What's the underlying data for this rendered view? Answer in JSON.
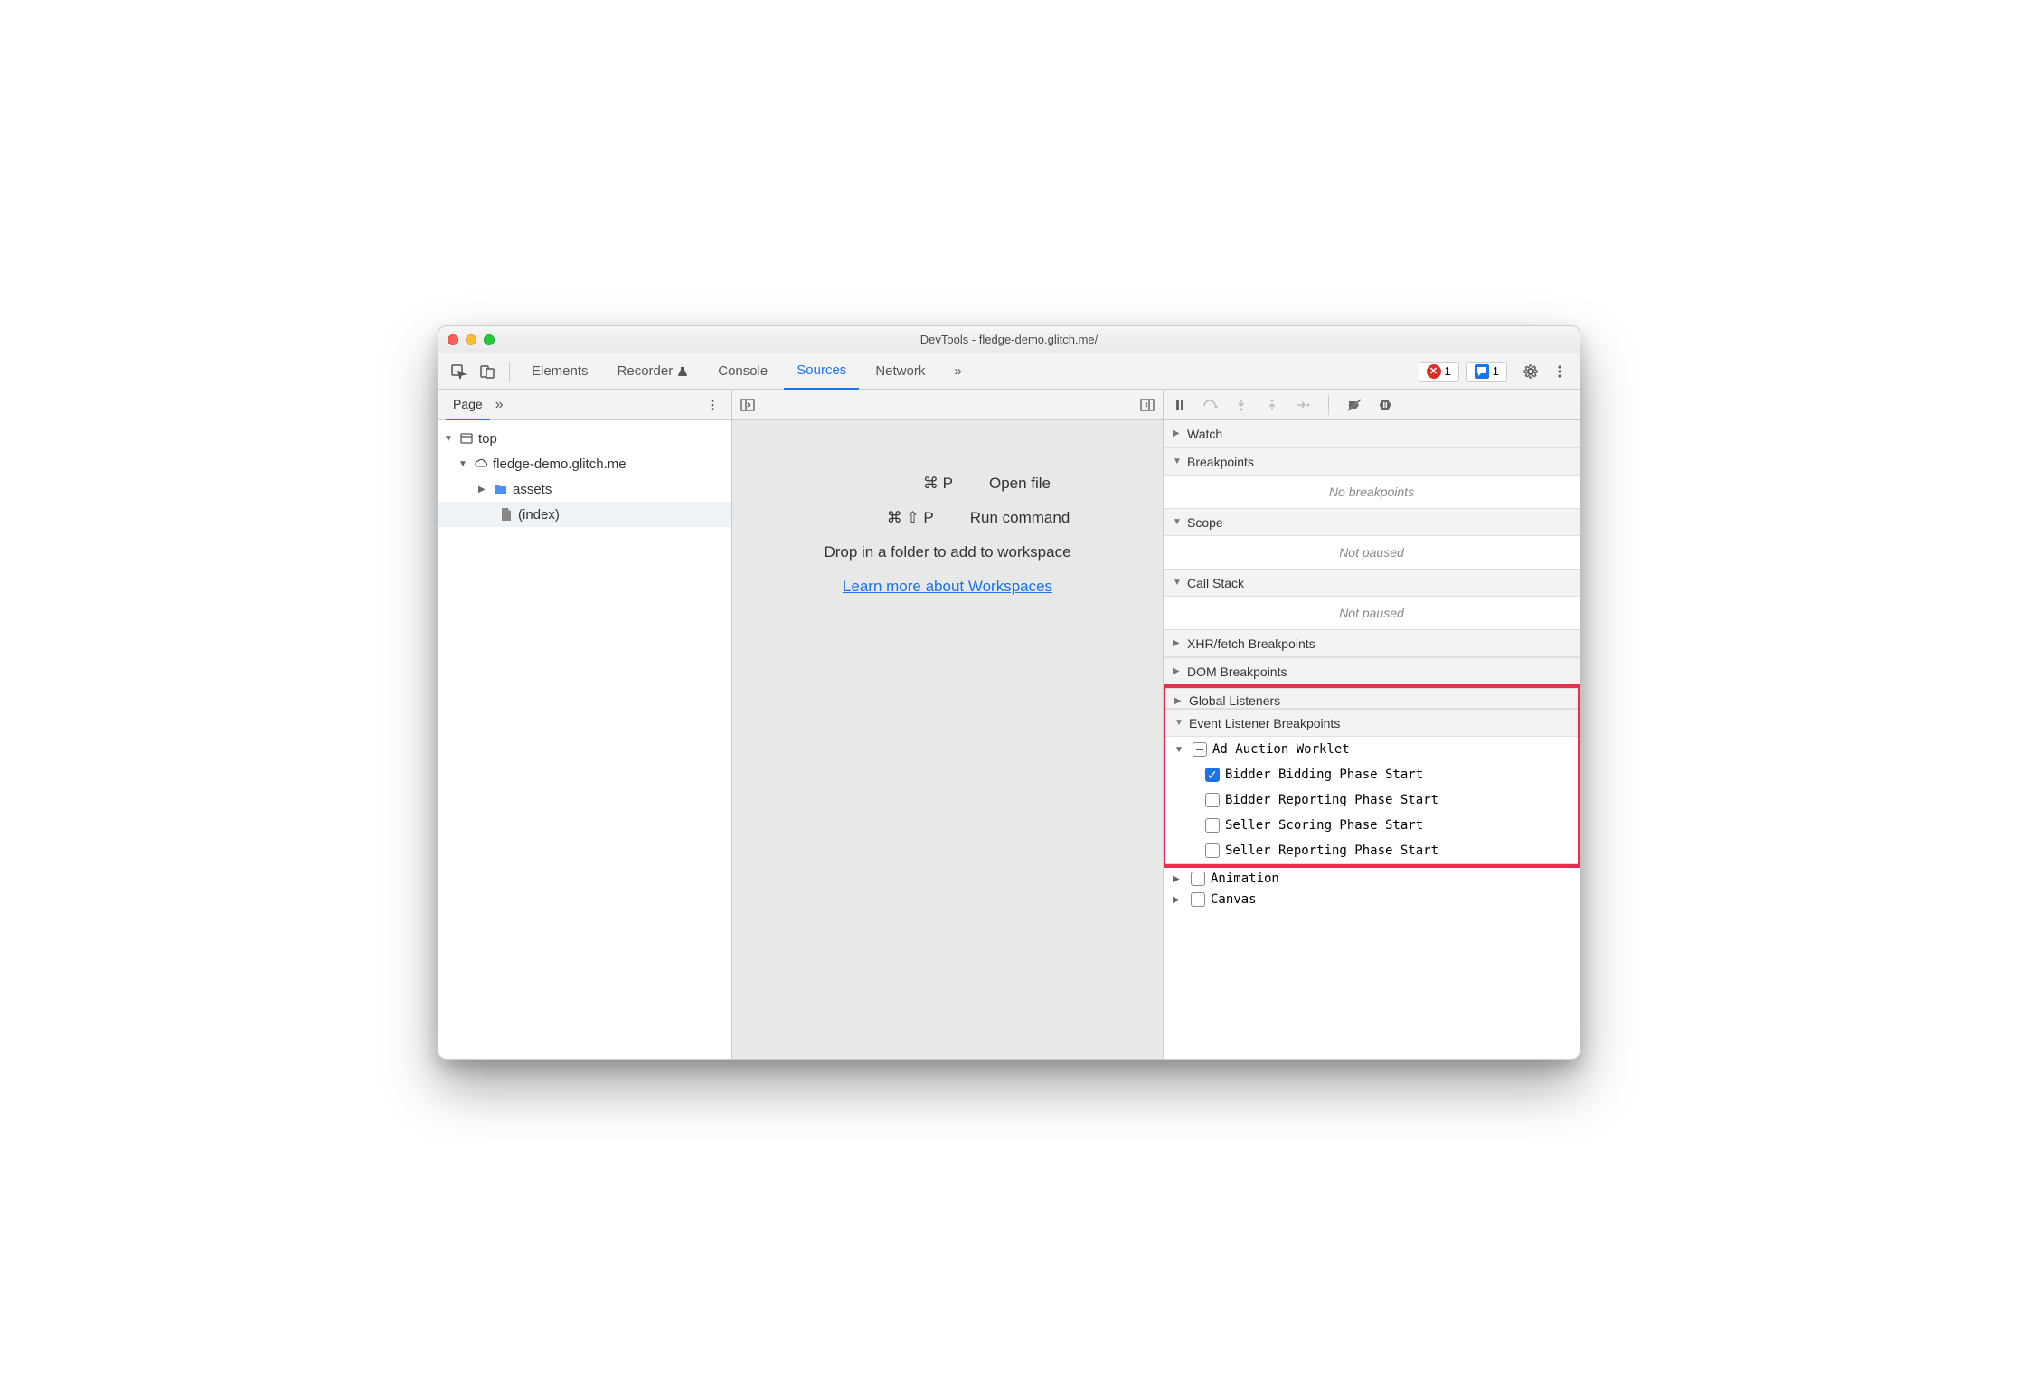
{
  "window": {
    "title": "DevTools - fledge-demo.glitch.me/"
  },
  "toolbar": {
    "tabs": {
      "elements": "Elements",
      "recorder": "Recorder",
      "console": "Console",
      "sources": "Sources",
      "network": "Network"
    },
    "errors_count": "1",
    "messages_count": "1"
  },
  "left": {
    "tab_page": "Page",
    "tree": {
      "top": "top",
      "domain": "fledge-demo.glitch.me",
      "assets": "assets",
      "index": "(index)"
    }
  },
  "center": {
    "open_file_keys": "⌘ P",
    "open_file_label": "Open file",
    "run_cmd_keys": "⌘ ⇧ P",
    "run_cmd_label": "Run command",
    "drop_hint": "Drop in a folder to add to workspace",
    "link": "Learn more about Workspaces"
  },
  "right": {
    "watch": "Watch",
    "breakpoints": "Breakpoints",
    "no_breakpoints": "No breakpoints",
    "scope": "Scope",
    "not_paused": "Not paused",
    "call_stack": "Call Stack",
    "xhr": "XHR/fetch Breakpoints",
    "dom_bp": "DOM Breakpoints",
    "global_listeners": "Global Listeners",
    "event_listener_bp": "Event Listener Breakpoints",
    "ad_auction": "Ad Auction Worklet",
    "events": {
      "bidder_bidding": "Bidder Bidding Phase Start",
      "bidder_reporting": "Bidder Reporting Phase Start",
      "seller_scoring": "Seller Scoring Phase Start",
      "seller_reporting": "Seller Reporting Phase Start"
    },
    "animation": "Animation",
    "canvas": "Canvas"
  }
}
